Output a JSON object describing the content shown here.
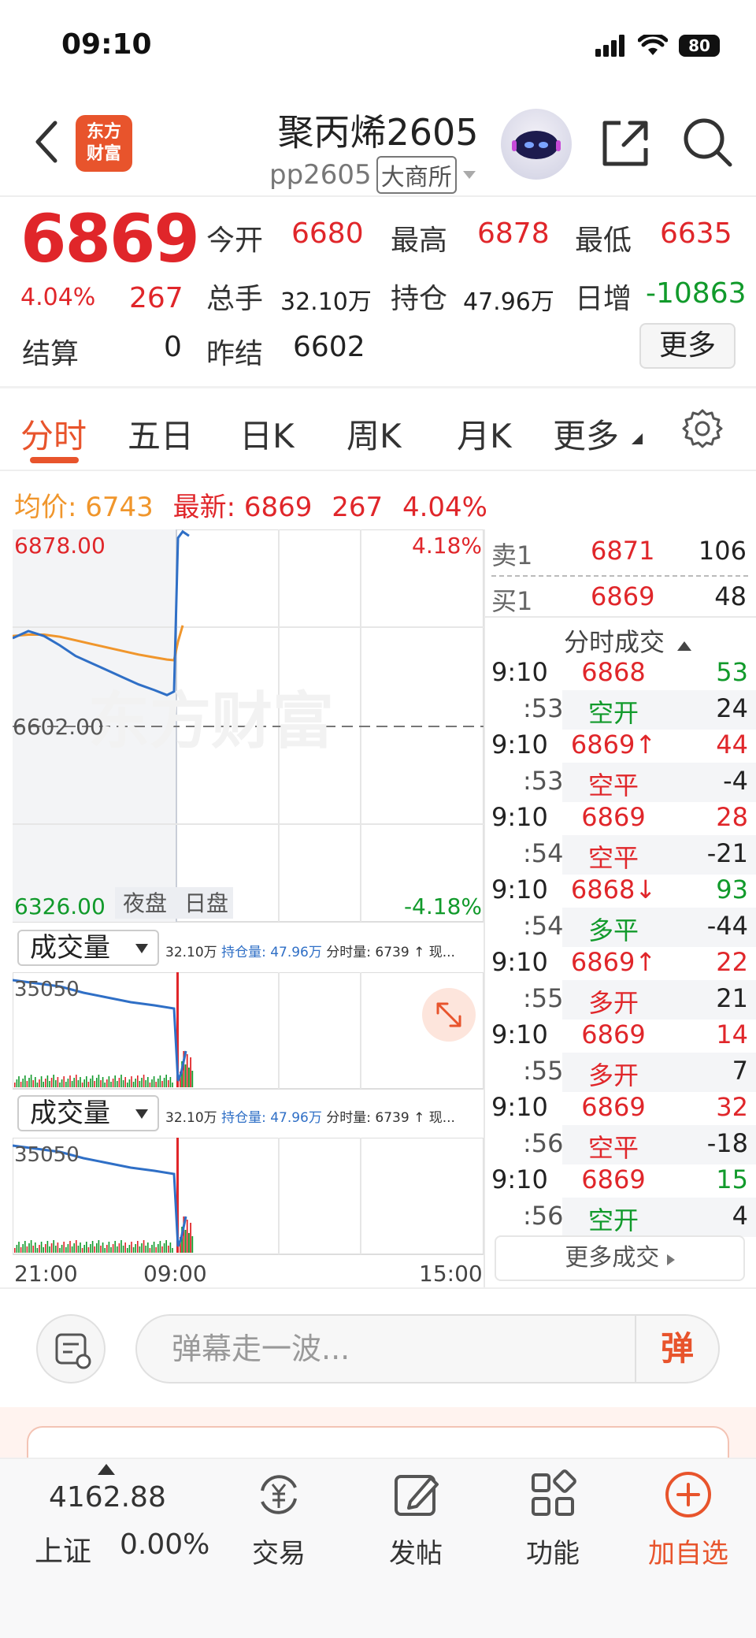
{
  "status_bar": {
    "time": "09:10",
    "battery": "80"
  },
  "header": {
    "logo_line1": "东方",
    "logo_line2": "财富",
    "title": "聚丙烯2605",
    "code": "pp2605",
    "exchange": "大商所"
  },
  "quote": {
    "price": "6869",
    "change_pct": "4.04%",
    "change": "267",
    "open_label": "今开",
    "open": "6680",
    "high_label": "最高",
    "high": "6878",
    "low_label": "最低",
    "low": "6635",
    "volume_label": "总手",
    "volume": "32.10万",
    "oi_label": "持仓",
    "oi": "47.96万",
    "oi_change_label": "日增",
    "oi_change": "-10863",
    "settle_label": "结算",
    "settle": "0",
    "prev_settle_label": "昨结",
    "prev_settle": "6602",
    "more_button": "更多"
  },
  "tabs": {
    "fenshi": "分时",
    "wuri": "五日",
    "rik": "日K",
    "zhouk": "周K",
    "yuek": "月K",
    "more": "更多"
  },
  "info_line": {
    "avg_label": "均价:",
    "avg": "6743",
    "latest_label": "最新:",
    "latest": "6869",
    "change": "267",
    "change_pct": "4.04%"
  },
  "chart": {
    "y_top": "6878.00",
    "y_mid": "6602.00",
    "y_bottom": "6326.00",
    "pct_top": "4.18%",
    "pct_bottom": "-4.18%",
    "night_label": "夜盘",
    "day_label": "日盘",
    "watermark": "东方财富",
    "vol_scale": "35050",
    "x_start": "21:00",
    "x_mid": "09:00",
    "x_end": "15:00",
    "colors": {
      "price_line": "#2f6fc6",
      "avg_line": "#f0962c",
      "up": "#e0262a",
      "down": "#119a2b"
    }
  },
  "chart_data": {
    "type": "line",
    "title": "",
    "xlabel": "",
    "ylabel": "",
    "x": [
      "21:00",
      "09:00",
      "15:00"
    ],
    "ylim": [
      6326,
      6878
    ],
    "series": [
      {
        "values": [
          6725,
          6735,
          6728,
          6715,
          6700,
          6690,
          6680,
          6670,
          6660,
          6652,
          6645,
          6650,
          6866,
          6875,
          6869
        ]
      },
      {
        "values": [
          6728,
          6730,
          6730,
          6727,
          6722,
          6717,
          6712,
          6707,
          6702,
          6698,
          6695,
          6694,
          6720,
          6743
        ]
      }
    ]
  },
  "volume_panels": [
    {
      "label": "成交量",
      "vol": "32.10万",
      "oi_text": "持仓量: 47.96万",
      "cur_text": "分时量: 6739 ↑ 现..."
    },
    {
      "label": "成交量",
      "vol": "32.10万",
      "oi_text": "持仓量: 47.96万",
      "cur_text": "分时量: 6739 ↑ 现..."
    }
  ],
  "order_book": {
    "ask_label": "卖1",
    "ask_price": "6871",
    "ask_vol": "106",
    "bid_label": "买1",
    "bid_price": "6869",
    "bid_vol": "48"
  },
  "trades_title": "分时成交",
  "trades": [
    {
      "time": "9:10",
      "price": "6868",
      "vol": "53",
      "pc": "red",
      "vc": "green"
    },
    {
      "time": ":53",
      "price": "空开",
      "vol": "24",
      "pc": "green",
      "vc": "dark"
    },
    {
      "time": "9:10",
      "price": "6869↑",
      "vol": "44",
      "pc": "red",
      "vc": "red"
    },
    {
      "time": ":53",
      "price": "空平",
      "vol": "-4",
      "pc": "red",
      "vc": "dark"
    },
    {
      "time": "9:10",
      "price": "6869",
      "vol": "28",
      "pc": "red",
      "vc": "red"
    },
    {
      "time": ":54",
      "price": "空平",
      "vol": "-21",
      "pc": "red",
      "vc": "dark"
    },
    {
      "time": "9:10",
      "price": "6868↓",
      "vol": "93",
      "pc": "red",
      "vc": "green"
    },
    {
      "time": ":54",
      "price": "多平",
      "vol": "-44",
      "pc": "green",
      "vc": "dark"
    },
    {
      "time": "9:10",
      "price": "6869↑",
      "vol": "22",
      "pc": "red",
      "vc": "red"
    },
    {
      "time": ":55",
      "price": "多开",
      "vol": "21",
      "pc": "red",
      "vc": "dark"
    },
    {
      "time": "9:10",
      "price": "6869",
      "vol": "14",
      "pc": "red",
      "vc": "red"
    },
    {
      "time": ":55",
      "price": "多开",
      "vol": "7",
      "pc": "red",
      "vc": "dark"
    },
    {
      "time": "9:10",
      "price": "6869",
      "vol": "32",
      "pc": "red",
      "vc": "red"
    },
    {
      "time": ":56",
      "price": "空平",
      "vol": "-18",
      "pc": "red",
      "vc": "dark"
    },
    {
      "time": "9:10",
      "price": "6869",
      "vol": "15",
      "pc": "red",
      "vc": "green"
    },
    {
      "time": ":56",
      "price": "空开",
      "vol": "4",
      "pc": "green",
      "vc": "dark"
    }
  ],
  "more_trades": "更多成交",
  "comment": {
    "placeholder": "弹幕走一波...",
    "danmu": "弹"
  },
  "bottom_nav": {
    "index_value": "4162.88",
    "index_name": "上证",
    "index_pct": "0.00%",
    "trade": "交易",
    "post": "发帖",
    "features": "功能",
    "add_watch": "加自选"
  }
}
